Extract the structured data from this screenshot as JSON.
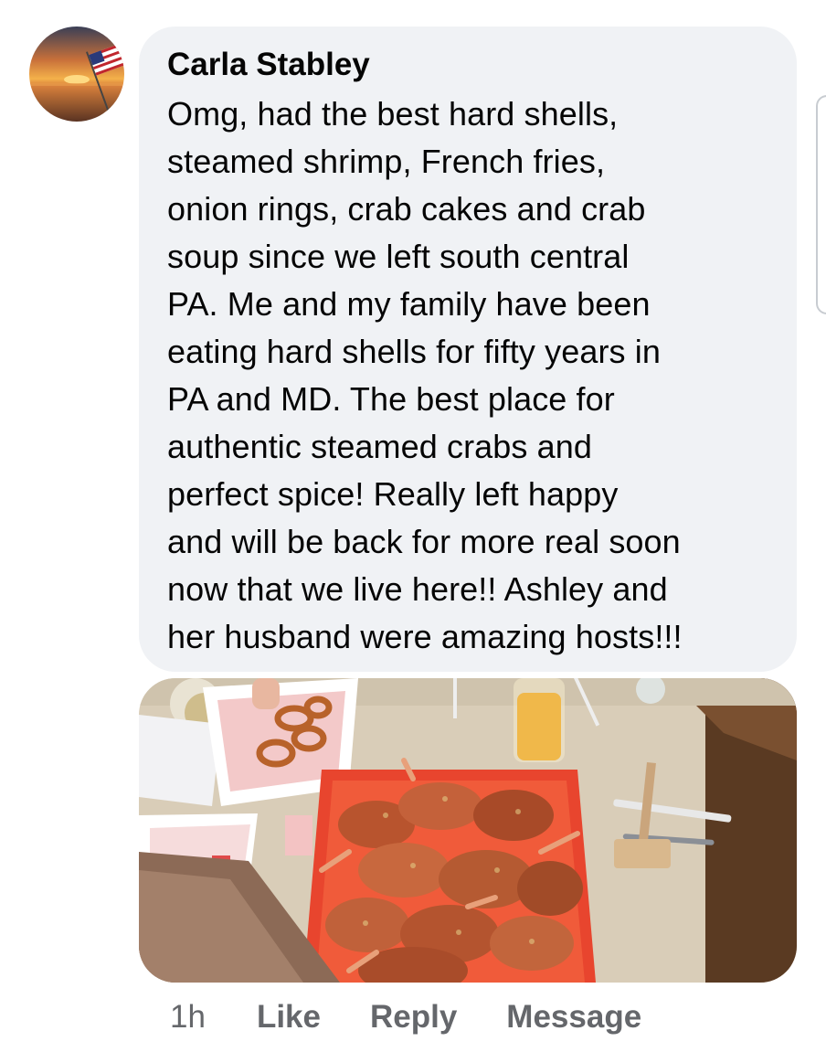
{
  "comment": {
    "author": "Carla Stabley",
    "text": "Omg, had the best hard shells,\nsteamed shrimp, French fries,\nonion rings, crab cakes and crab\nsoup since we left south central\nPA.  Me and my family have been\neating hard shells for fifty years in\nPA and MD.  The best place for\nauthentic steamed crabs and\nperfect spice!  Really left happy\nand will be back for more real soon\nnow that we live here!! Ashley and\nher husband were amazing hosts!!!"
  },
  "actions": {
    "time": "1h",
    "like": "Like",
    "reply": "Reply",
    "message": "Message"
  },
  "colors": {
    "bubble": "#f0f2f5",
    "text": "#050505",
    "meta": "#65676b"
  }
}
